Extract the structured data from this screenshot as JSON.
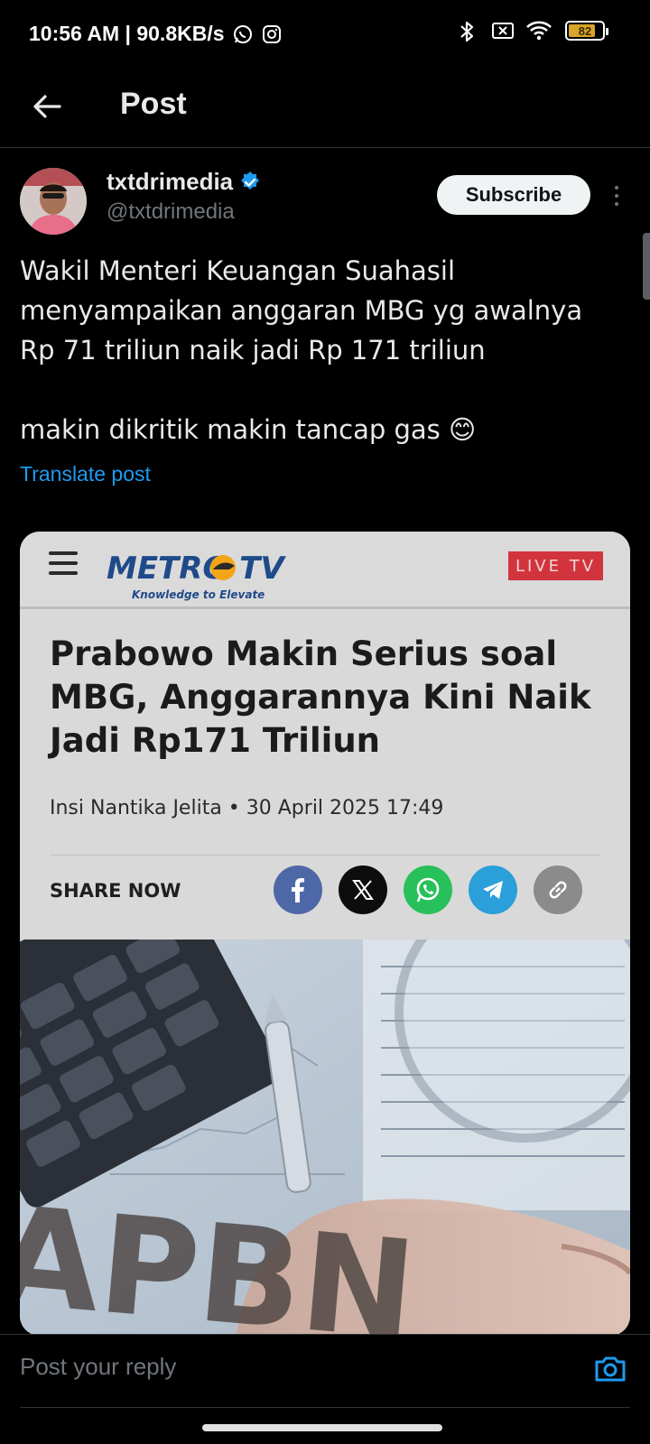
{
  "status_bar": {
    "time_speed": "10:56 AM | 90.8KB/s",
    "battery_level": "82",
    "battery_fraction": 0.82,
    "icons": [
      "whatsapp-icon",
      "instagram-icon",
      "bluetooth-icon",
      "no-sim-icon",
      "wifi-icon",
      "battery-icon"
    ]
  },
  "header": {
    "title": "Post",
    "back_icon": "back-arrow-icon"
  },
  "post": {
    "author": {
      "display_name": "txtdrimedia",
      "handle": "@txtdrimedia",
      "verified": true
    },
    "subscribe_label": "Subscribe",
    "text_line1": "Wakil Menteri Keuangan Suahasil\nmenyampaikan anggaran MBG yg awalnya\nRp 71 triliun naik jadi Rp 171 triliun",
    "text_line2": "makin dikritik makin tancap gas 😊",
    "translate_label": "Translate post"
  },
  "media": {
    "brand_name": "METRO TV",
    "tagline": "Knowledge to Elevate",
    "live_badge": "LIVE TV",
    "headline": "Prabowo Makin Serius soal MBG, Anggarannya Kini Naik Jadi Rp171 Triliun",
    "byline": "Insi Nantika Jelita • 30 April 2025 17:49",
    "share_label": "SHARE NOW",
    "share_icons": [
      "facebook-icon",
      "x-icon",
      "whatsapp-icon",
      "telegram-icon",
      "link-icon"
    ],
    "photo_text": "APBN",
    "accent_colors": {
      "facebook": "#3b5998",
      "x": "#000000",
      "whatsapp": "#25d366",
      "telegram": "#229ed9",
      "link": "#8a8a8a",
      "live": "#d2343e"
    }
  },
  "reply": {
    "placeholder": "Post your reply"
  }
}
